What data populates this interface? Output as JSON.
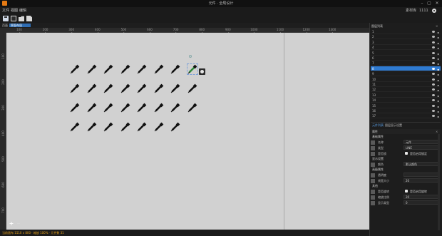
{
  "window": {
    "title": "元件 · 全局设计",
    "min": "–",
    "restore": "▢",
    "close": "✕"
  },
  "menu": {
    "items": [
      "文件",
      "视图",
      "编辑"
    ],
    "right_label": "素材库",
    "right_value": "1111"
  },
  "toolbar": {
    "icons": [
      "save-icon",
      "new-file-icon",
      "open-folder-icon",
      "export-icon"
    ]
  },
  "canvas": {
    "header_label": "页面",
    "tab_label": "界面布局",
    "ruler_top_ticks": [
      "100",
      "200",
      "300",
      "400",
      "500",
      "600",
      "700",
      "800",
      "900",
      "1000",
      "1100",
      "1200",
      "1300"
    ],
    "ruler_left_ticks": [
      "100",
      "200",
      "300",
      "400",
      "500",
      "600",
      "700"
    ],
    "grid": {
      "rows": 4,
      "cols": 8,
      "missing": [
        [
          3,
          7
        ]
      ],
      "selected": [
        0,
        7
      ]
    },
    "background": "#d1d1d1"
  },
  "zoom": {
    "plus": "+",
    "minus": "−"
  },
  "status": {
    "text": "当前画布 1510 x 800 · 缩放 100% · 元件数 31"
  },
  "layers_panel": {
    "title": "图层列表",
    "close": "×",
    "rows": [
      "1",
      "2",
      "3",
      "4",
      "5",
      "6",
      "7",
      "8",
      "9",
      "10",
      "11",
      "12",
      "13",
      "14",
      "15",
      "16",
      "17"
    ],
    "active_index": 7
  },
  "dock_tabs": [
    "元件列表",
    "图层显示设置"
  ],
  "properties": {
    "title": "属性",
    "close": "×",
    "groups": [
      {
        "label": "基础属性",
        "rows": [
          {
            "key": "名称",
            "value": "元件"
          },
          {
            "key": "类型",
            "value": "LINE"
          },
          {
            "key": "是否锁",
            "check": true,
            "check_label": "是否启用锁定"
          }
        ]
      },
      {
        "label": "显示设置",
        "rows": [
          {
            "key": "颜色",
            "value": "默认颜色"
          }
        ]
      },
      {
        "label": "高级属性",
        "rows": [
          {
            "key": "透明度",
            "value": ""
          },
          {
            "key": "线宽大小",
            "value": "20"
          }
        ]
      },
      {
        "label": "其他",
        "rows": [
          {
            "key": "是否旋转",
            "check": true,
            "check_label": "是否启用旋转"
          },
          {
            "key": "缩放比例",
            "value": "20"
          },
          {
            "key": "显示类型",
            "value": "0"
          }
        ]
      }
    ]
  },
  "colors": {
    "accent": "#2f7bd2",
    "status": "#e8a21a",
    "logo": "#e57a13"
  }
}
